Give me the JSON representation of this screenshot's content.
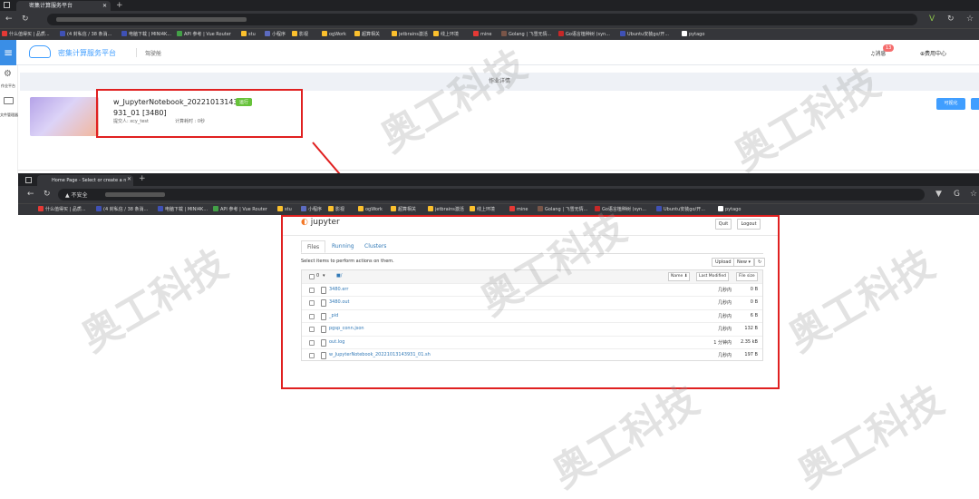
{
  "top_browser": {
    "tab_title": "密集计算服务平台",
    "url_hidden": "",
    "bookmarks": [
      "什么值得买 | 品质...",
      "(4 封私信 / 38 条消...",
      "电脑下载 | MINI4K...",
      "API 参考 | Vue Router",
      "stu",
      "小程序",
      "影视",
      "ogWork",
      "超算相关",
      "jetbrains激活",
      "线上环境",
      "mine",
      "Golang | 飞雪无情...",
      "Go语言植种树 (syn...",
      "Ubuntu安装go/开...",
      "pytago"
    ]
  },
  "app": {
    "title": "密集计算服务平台",
    "subtitle": "驾驶舱",
    "messages_label": "消息",
    "message_count": "13",
    "fee_center": "费用中心",
    "side_items": [
      "作业平台",
      "文件管理器"
    ],
    "detail_header": "作业详情",
    "job": {
      "name_line1": "w_JupyterNotebook_20221013143",
      "name_line2": "931_01 [3480]",
      "status": "运行",
      "submitter_label": "提交人: xcy_test",
      "duration_label": "计算耗时 : 0秒"
    },
    "visualize_button": "可视化"
  },
  "bottom_browser": {
    "tab_title": "Home Page - Select or create a n",
    "insecure_label": "不安全",
    "bookmarks": [
      "什么值得买 | 品质...",
      "(4 封私信 / 38 条消...",
      "电脑下载 | MINI4K...",
      "API 参考 | Vue Router",
      "stu",
      "小程序",
      "影视",
      "ogWork",
      "超算相关",
      "jetbrains激活",
      "线上环境",
      "mine",
      "Golang | 飞雪无情...",
      "Go语言植种树 (syn...",
      "Ubuntu安装go/开...",
      "pytago"
    ]
  },
  "jupyter": {
    "logo": "jupyter",
    "quit": "Quit",
    "logout": "Logout",
    "tabs": [
      "Files",
      "Running",
      "Clusters"
    ],
    "select_text": "Select items to perform actions on them.",
    "upload": "Upload",
    "new": "New ▾",
    "refresh": "↻",
    "header": {
      "count": "0",
      "path": "/",
      "name_col": "Name ⬇",
      "modified_col": "Last Modified",
      "size_col": "File size"
    },
    "files": [
      {
        "name": "3480.err",
        "modified": "几秒内",
        "size": "0 B"
      },
      {
        "name": "3480.out",
        "modified": "几秒内",
        "size": "0 B"
      },
      {
        "name": "_pid",
        "modified": "几秒内",
        "size": "6 B"
      },
      {
        "name": "pgsp_conn.json",
        "modified": "几秒内",
        "size": "132 B"
      },
      {
        "name": "out.log",
        "modified": "1 分钟内",
        "size": "2.35 kB"
      },
      {
        "name": "w_JupyterNotebook_20221013143931_01.sh",
        "modified": "几秒内",
        "size": "197 B"
      }
    ]
  },
  "watermark": "奥工科技",
  "colors": {
    "accent": "#409eff",
    "annotation": "#e02020",
    "status_green": "#67c23a"
  }
}
